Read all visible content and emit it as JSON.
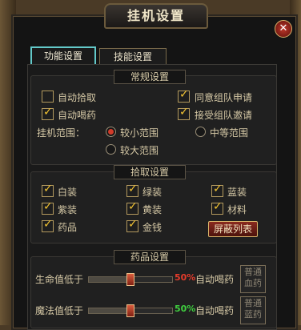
{
  "window": {
    "title": "挂机设置",
    "close_glyph": "✕"
  },
  "tabs": [
    {
      "label": "功能设置",
      "active": true
    },
    {
      "label": "技能设置",
      "active": false
    }
  ],
  "general": {
    "title": "常规设置",
    "auto_pickup": {
      "label": "自动拾取",
      "checked": false
    },
    "auto_drink": {
      "label": "自动喝药",
      "checked": true
    },
    "agree_team": {
      "label": "同意组队申请",
      "checked": true
    },
    "accept_invite": {
      "label": "接受组队邀请",
      "checked": true
    },
    "range_label": "挂机范围：",
    "range_options": [
      {
        "label": "较小范围",
        "selected": true
      },
      {
        "label": "中等范围",
        "selected": false
      },
      {
        "label": "较大范围",
        "selected": false
      }
    ]
  },
  "pickup": {
    "title": "拾取设置",
    "items": [
      {
        "label": "白装",
        "checked": true
      },
      {
        "label": "绿装",
        "checked": true
      },
      {
        "label": "蓝装",
        "checked": true
      },
      {
        "label": "紫装",
        "checked": true
      },
      {
        "label": "黄装",
        "checked": true
      },
      {
        "label": "材料",
        "checked": true
      },
      {
        "label": "药品",
        "checked": true
      },
      {
        "label": "金钱",
        "checked": true
      }
    ],
    "block_list_label": "屏蔽列表"
  },
  "potion": {
    "title": "药品设置",
    "hp": {
      "label": "生命值低于",
      "percent": "50%",
      "level": 0.5,
      "action": "自动喝药",
      "button": [
        "普通",
        "血药"
      ],
      "color": "#e53b2b"
    },
    "mp": {
      "label": "魔法值低于",
      "percent": "50%",
      "level": 0.5,
      "action": "自动喝药",
      "button": [
        "普通",
        "蓝药"
      ],
      "color": "#3fcf3f"
    }
  },
  "colors": {
    "accent_tab": "#63c9c9",
    "tick": "#f1c232",
    "radio_selected": "#d23b2a"
  }
}
